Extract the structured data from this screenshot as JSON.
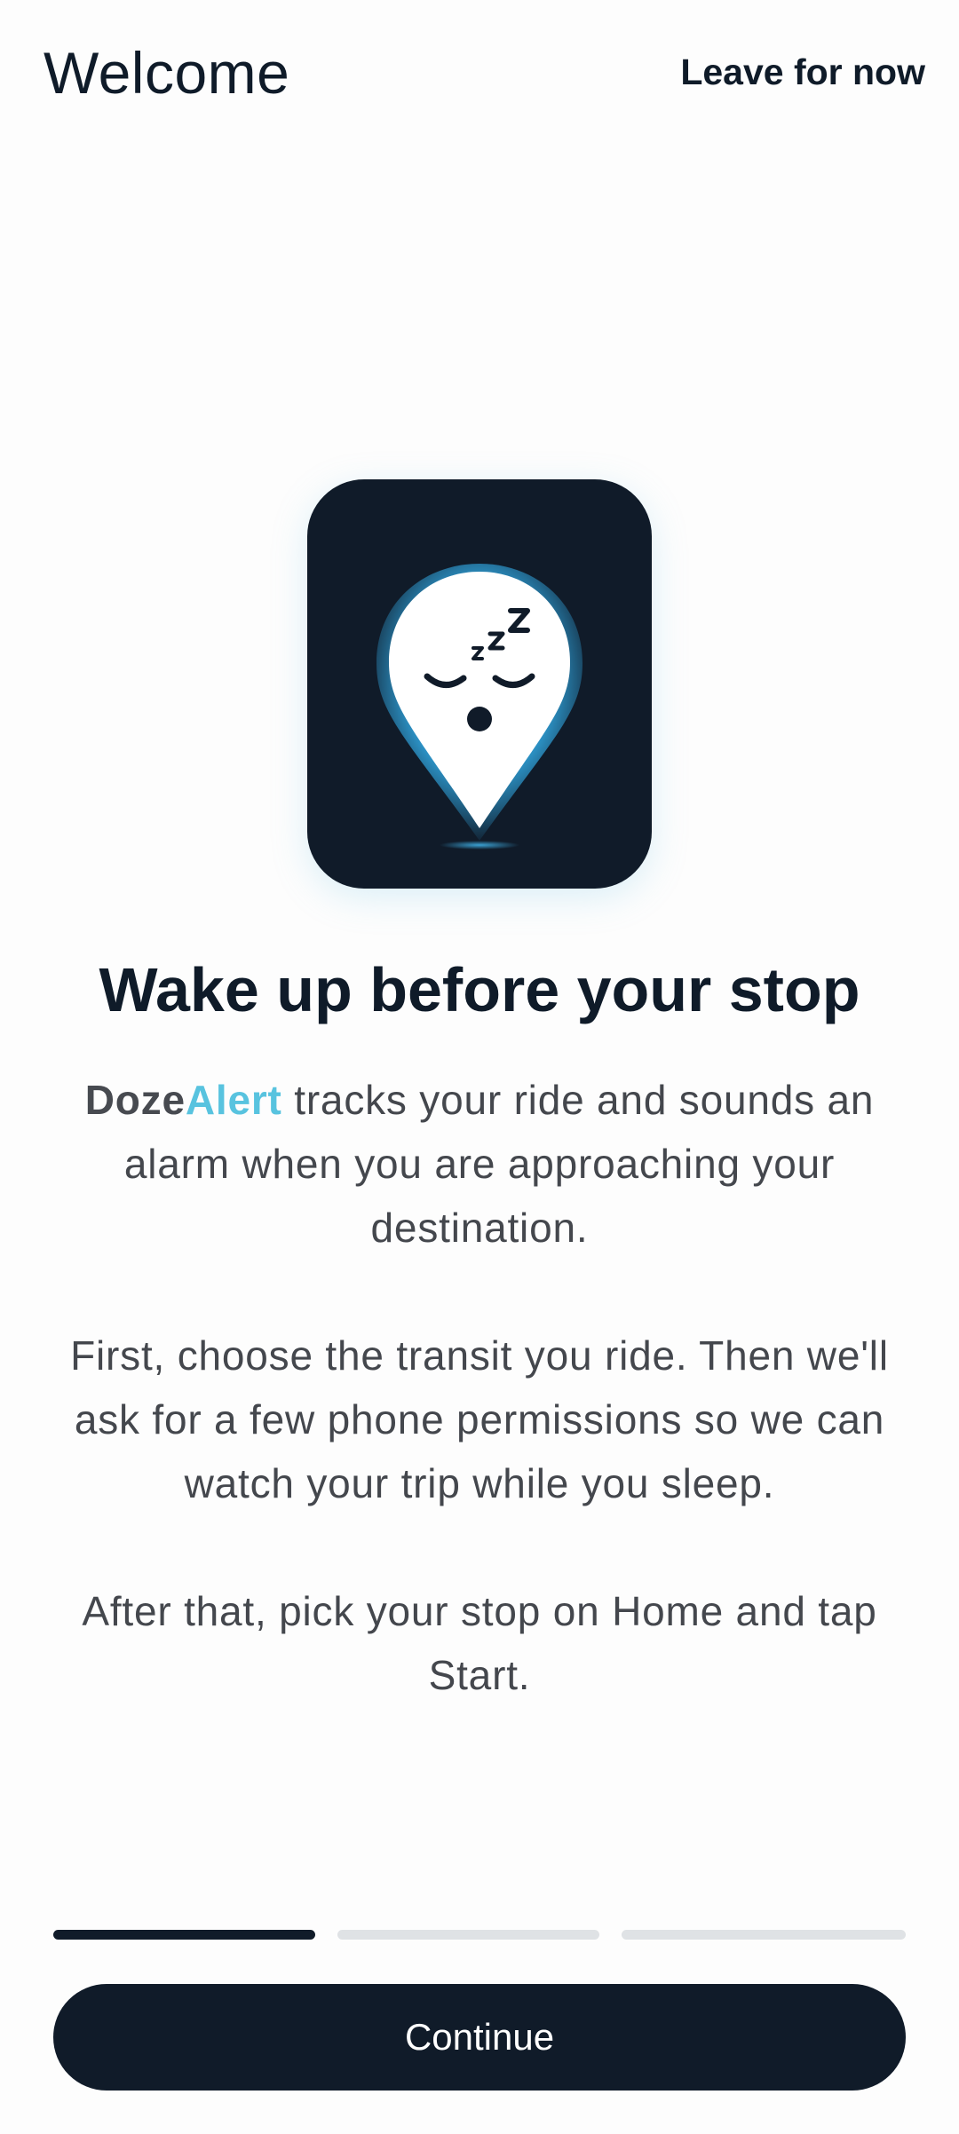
{
  "header": {
    "title": "Welcome",
    "leave_label": "Leave for now"
  },
  "hero": {
    "icon": "sleeping-location-pin-icon",
    "headline": "Wake up before your stop"
  },
  "body": {
    "brand_doze": "Doze",
    "brand_alert": "Alert",
    "p1_rest": " tracks your ride and sounds an alarm when you are approaching your destination.",
    "p2": "First, choose the transit you ride. Then we'll ask for a few phone permissions so we can watch your trip while you sleep.",
    "p3": "After that, pick your stop on Home and tap Start."
  },
  "progress": {
    "current_step": 1,
    "total_steps": 3
  },
  "footer": {
    "continue_label": "Continue"
  },
  "colors": {
    "primary_dark": "#101b29",
    "brand_accent": "#58c3df",
    "body_text": "#44474d",
    "inactive_segment": "#dfe2e5"
  }
}
